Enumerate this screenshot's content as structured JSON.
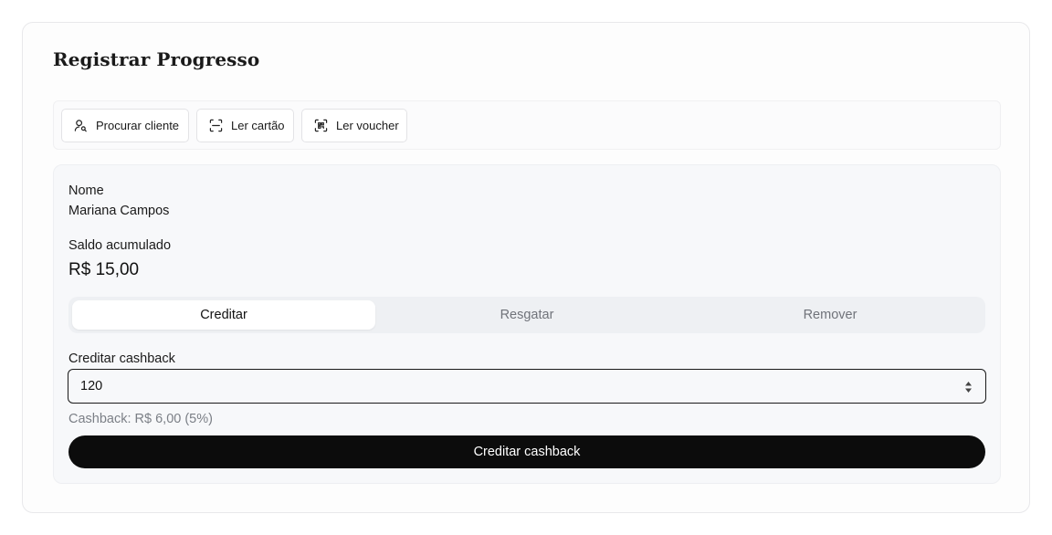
{
  "page": {
    "title": "Registrar Progresso"
  },
  "toolbar": {
    "search_client": {
      "label": "Procurar cliente",
      "icon": "user-search-icon"
    },
    "read_card": {
      "label": "Ler cartão",
      "icon": "scan-icon"
    },
    "read_voucher": {
      "label": "Ler voucher",
      "icon": "scan-qr-icon"
    }
  },
  "customer": {
    "name_label": "Nome",
    "name_value": "Mariana Campos",
    "balance_label": "Saldo acumulado",
    "balance_value": "R$ 15,00"
  },
  "tabs": [
    {
      "label": "Creditar",
      "active": true
    },
    {
      "label": "Resgatar",
      "active": false
    },
    {
      "label": "Remover",
      "active": false
    }
  ],
  "form": {
    "amount_label": "Creditar cashback",
    "amount_value": "120",
    "cashback_hint": "Cashback: R$ 6,00 (5%)",
    "submit_label": "Creditar cashback"
  },
  "colors": {
    "primary_button": "#0c0c0c",
    "muted_text": "#7b7f86",
    "panel_bg": "#f7f8fa"
  }
}
